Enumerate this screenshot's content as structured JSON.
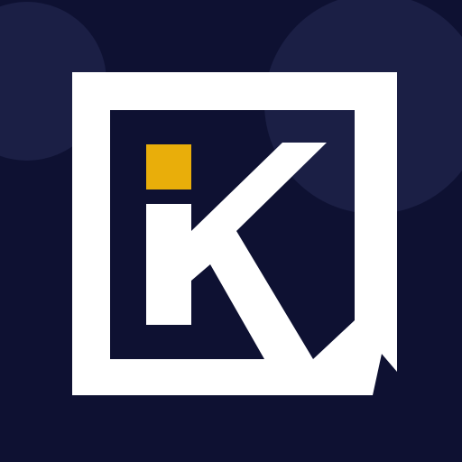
{
  "logo": {
    "icon": "ik-monogram-logo-icon",
    "colors": {
      "background": "#0e1132",
      "background_bubble": "#1b1f45",
      "frame": "#ffffff",
      "letter": "#ffffff",
      "accent_square": "#e9ae0a"
    }
  }
}
